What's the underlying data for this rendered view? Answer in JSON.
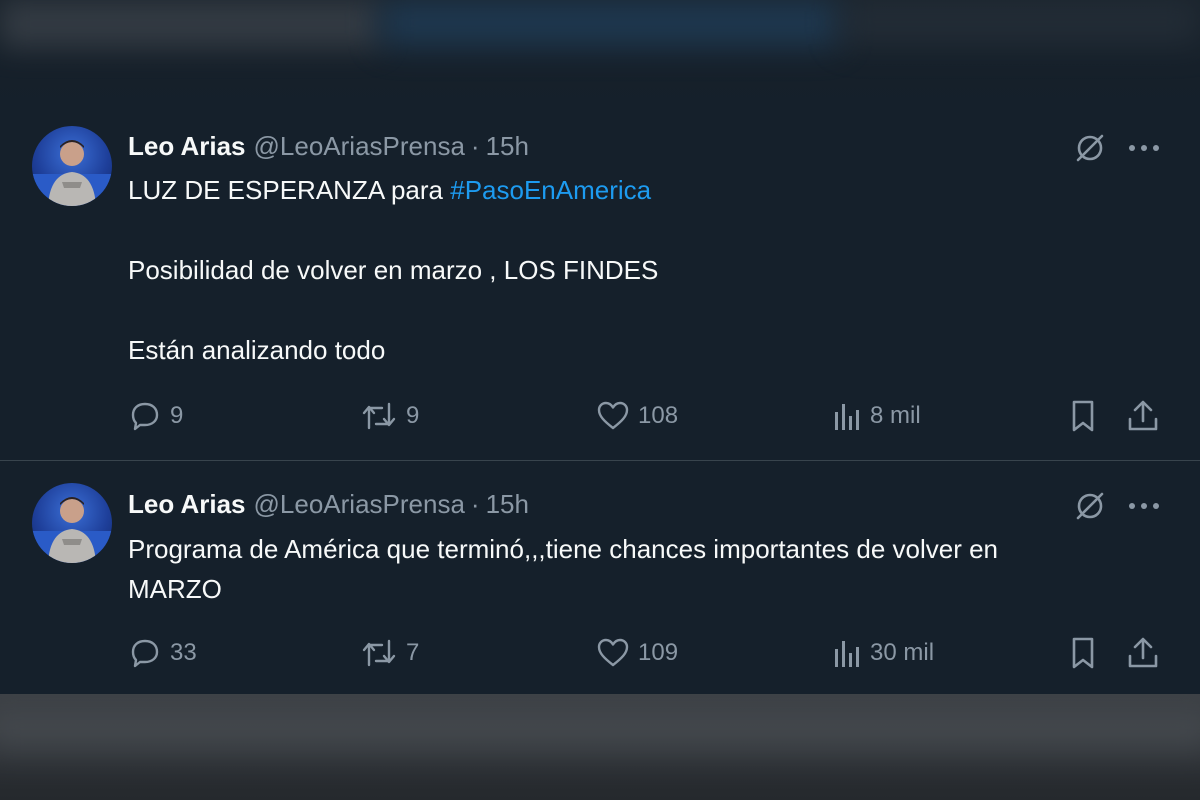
{
  "tweets": [
    {
      "author_name": "Leo Arias",
      "handle": "@LeoAriasPrensa",
      "separator": "·",
      "time": "15h",
      "text_line1_prefix": "LUZ DE ESPERANZA para ",
      "hashtag": "#PasoEnAmerica",
      "text_line2": "Posibilidad de volver en marzo , LOS FINDES",
      "text_line3": "Están analizando todo",
      "replies": "9",
      "retweets": "9",
      "likes": "108",
      "views": "8 mil"
    },
    {
      "author_name": "Leo Arias",
      "handle": "@LeoAriasPrensa",
      "separator": "·",
      "time": "15h",
      "text_line1": "Programa de América que terminó,,,tiene chances importantes de volver en",
      "text_line2": "MARZO",
      "replies": "33",
      "retweets": "7",
      "likes": "109",
      "views": "30 mil"
    }
  ],
  "icons": {
    "reply": "reply-icon",
    "retweet": "retweet-icon",
    "like": "heart-icon",
    "views": "analytics-icon",
    "bookmark": "bookmark-icon",
    "share": "share-icon",
    "grok": "grok-icon",
    "more": "more-icon"
  },
  "colors": {
    "background": "#15202b",
    "text": "#f7f9f9",
    "muted": "#8b98a5",
    "accent": "#1d9bf0",
    "divider": "#38444d"
  }
}
